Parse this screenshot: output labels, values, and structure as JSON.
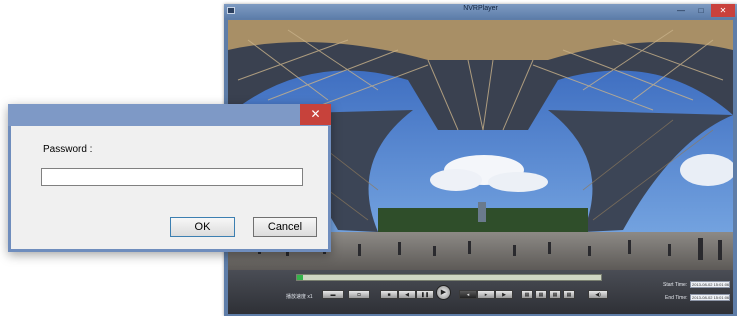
{
  "player": {
    "title": "NVRPlayer",
    "window_controls": {
      "minimize": "—",
      "maximize": "□",
      "close": "✕"
    },
    "speed_label": "播放速度 x1",
    "progress_fraction": 0.02,
    "start_time_label": "Start Time:",
    "start_time_value": "2013-08-02  15:01:06",
    "end_time_label": "End Time:",
    "end_time_value": "2013-08-02  15:01:06"
  },
  "dialog": {
    "close_icon": "✕",
    "password_label": "Password :",
    "password_value": "",
    "ok_label": "OK",
    "cancel_label": "Cancel"
  },
  "colors": {
    "title_bar": "#7e9bc2",
    "close_red": "#c9413c",
    "progress_green": "#35b34a"
  }
}
